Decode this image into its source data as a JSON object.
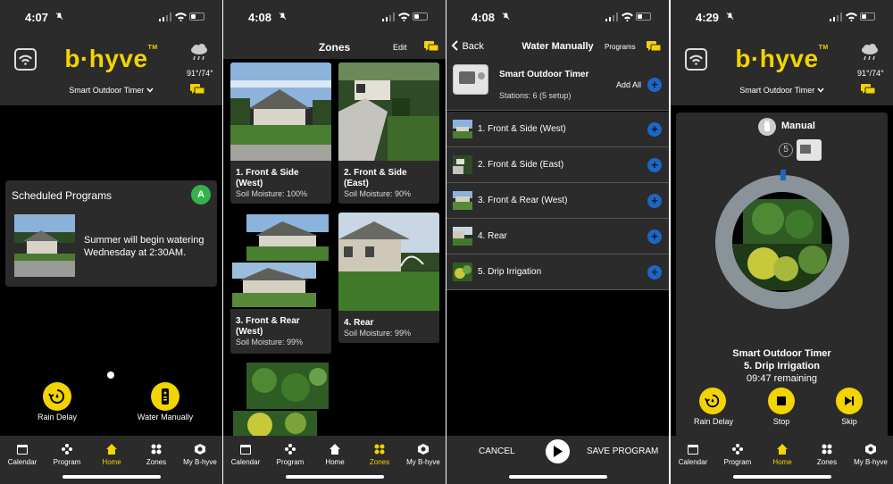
{
  "panels": [
    {
      "time": "4:07",
      "brand": "b·hyve",
      "weather_temp": "91°/74°",
      "device": "Smart Outdoor Timer",
      "schedule": {
        "title": "Scheduled Programs",
        "badge": "A",
        "message": "Summer will begin watering Wednesday at 2:30AM."
      },
      "actions": {
        "rain_delay": "Rain Delay",
        "water_manually": "Water Manually"
      },
      "active_tab": "Home"
    },
    {
      "time": "4:08",
      "title": "Zones",
      "edit": "Edit",
      "zones": [
        {
          "name": "1. Front & Side (West)",
          "moisture": "Soil Moisture: 100%"
        },
        {
          "name": "2. Front & Side (East)",
          "moisture": "Soil Moisture: 90%"
        },
        {
          "name": "3. Front & Rear (West)",
          "moisture": "Soil Moisture: 99%"
        },
        {
          "name": "4. Rear",
          "moisture": "Soil Moisture: 99%"
        }
      ],
      "active_tab": "Zones"
    },
    {
      "time": "4:08",
      "back": "Back",
      "title": "Water Manually",
      "programs": "Programs",
      "timer_name": "Smart Outdoor Timer",
      "stations": "Stations: 6 (5 setup)",
      "add_all": "Add All",
      "zones": [
        "1. Front & Side (West)",
        "2. Front & Side (East)",
        "3. Front & Rear (West)",
        "4. Rear",
        "5. Drip Irrigation"
      ],
      "cancel": "CANCEL",
      "save": "SAVE PROGRAM"
    },
    {
      "time": "4:29",
      "brand": "b·hyve",
      "weather_temp": "91°/74°",
      "device": "Smart Outdoor Timer",
      "mode": "Manual",
      "station_number": "5",
      "status_device": "Smart Outdoor Timer",
      "status_zone": "5. Drip Irrigation",
      "remaining": "09:47 remaining",
      "actions": {
        "rain_delay": "Rain Delay",
        "stop": "Stop",
        "skip": "Skip"
      },
      "active_tab": "Home"
    }
  ],
  "nav": [
    "Calendar",
    "Program",
    "Home",
    "Zones",
    "My B-hyve"
  ],
  "colors": {
    "accent": "#f2d400",
    "card": "#2b2b2b",
    "badge_green": "#34b34a",
    "plus_blue": "#1d67c4"
  }
}
